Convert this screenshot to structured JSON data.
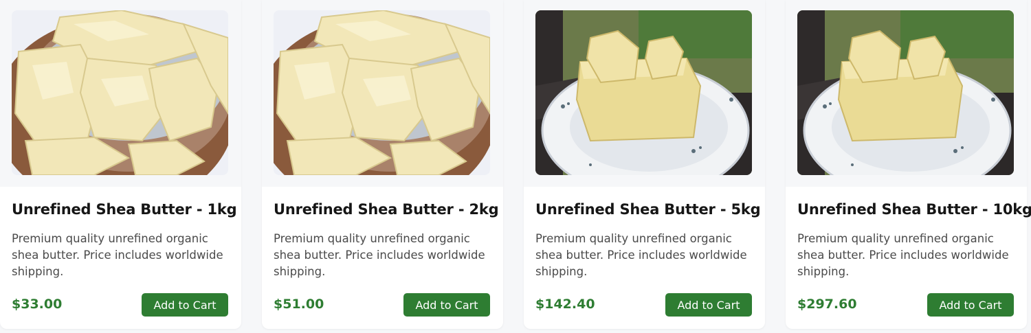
{
  "products": [
    {
      "title": "Unrefined Shea Butter - 1kg",
      "description": "Premium quality unrefined organic shea butter. Price includes worldwide shipping.",
      "price": "$33.00",
      "button_label": "Add to Cart",
      "image": "shea-butter-chunks-in-bowl"
    },
    {
      "title": "Unrefined Shea Butter - 2kg",
      "description": "Premium quality unrefined organic shea butter. Price includes worldwide shipping.",
      "price": "$51.00",
      "button_label": "Add to Cart",
      "image": "shea-butter-chunks-in-bowl"
    },
    {
      "title": "Unrefined Shea Butter - 5kg",
      "description": "Premium quality unrefined organic shea butter. Price includes worldwide shipping.",
      "price": "$142.40",
      "button_label": "Add to Cart",
      "image": "shea-butter-block-on-plate"
    },
    {
      "title": "Unrefined Shea Butter - 10kg",
      "description": "Premium quality unrefined organic shea butter. Price includes worldwide shipping.",
      "price": "$297.60",
      "button_label": "Add to Cart",
      "image": "shea-butter-block-on-plate"
    }
  ],
  "colors": {
    "accent": "#2e7d32",
    "page_background": "#f6f7f9",
    "card_background": "#ffffff",
    "title_text": "#161616",
    "body_text": "#4a4a4a"
  }
}
